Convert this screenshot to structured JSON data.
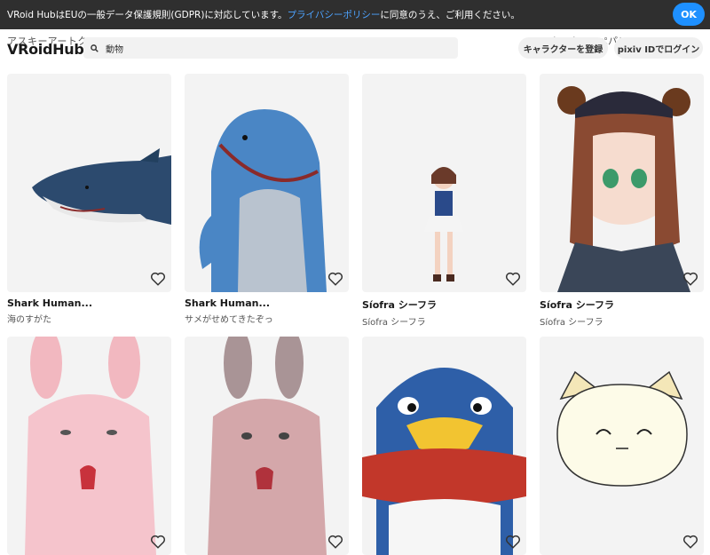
{
  "cookie_bar": {
    "text_before": "VRoid HubはEUの一般データ保護規則(GDPR)に対応しています。",
    "link_text": "プライバシーポリシー",
    "text_after": "に同意のうえ、ご利用ください。",
    "ok_label": "OK"
  },
  "header": {
    "logo": "VRoidHub",
    "ghost_left": "アスキーアートク",
    "ghost_right": "ルナルナコッペパン",
    "search_value": "動物",
    "register_label": "キャラクターを登録",
    "login_label": "pixiv IDでログイン"
  },
  "cards": [
    {
      "title": "Shark Human...",
      "author": "海のすがた"
    },
    {
      "title": "Shark Human...",
      "author": "サメがせめてきたぞっ"
    },
    {
      "title": "Síofra シーフラ",
      "author": "Síofra シーフラ"
    },
    {
      "title": "Síofra シーフラ",
      "author": "Síofra シーフラ"
    },
    {
      "title": "",
      "author": ""
    },
    {
      "title": "",
      "author": ""
    },
    {
      "title": "",
      "author": ""
    },
    {
      "title": "",
      "author": ""
    }
  ],
  "colors": {
    "accent": "#1e90ff",
    "cookie_bg": "#2f2f2f",
    "link": "#4da3ff"
  }
}
